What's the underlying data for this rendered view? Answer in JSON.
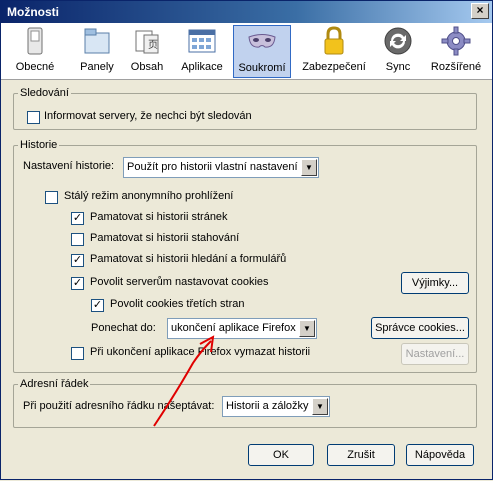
{
  "window": {
    "title": "Možnosti",
    "close_label": "×"
  },
  "toolbar": {
    "tabs": [
      {
        "label": "Obecné",
        "icon": "switch-icon"
      },
      {
        "label": "Panely",
        "icon": "tabs-icon"
      },
      {
        "label": "Obsah",
        "icon": "document-icon"
      },
      {
        "label": "Aplikace",
        "icon": "applications-icon"
      },
      {
        "label": "Soukromí",
        "icon": "mask-icon"
      },
      {
        "label": "Zabezpečení",
        "icon": "lock-icon"
      },
      {
        "label": "Sync",
        "icon": "sync-icon"
      },
      {
        "label": "Rozšířené",
        "icon": "gear-icon"
      }
    ],
    "active": "Soukromí"
  },
  "tracking": {
    "legend": "Sledování",
    "dnt_label": "Informovat servery, že nechci být sledován",
    "dnt_checked": false
  },
  "history": {
    "legend": "Historie",
    "settings_label": "Nastavení historie:",
    "settings_value": "Použít pro historii vlastní nastavení",
    "private_label": "Stálý režim anonymního prohlížení",
    "private_checked": false,
    "browsing_label": "Pamatovat si historii stránek",
    "browsing_checked": true,
    "download_label": "Pamatovat si historii stahování",
    "download_checked": false,
    "forms_label": "Pamatovat si historii hledání a formulářů",
    "forms_checked": true,
    "cookies_label": "Povolit serverům nastavovat cookies",
    "cookies_checked": true,
    "exceptions_button": "Výjimky...",
    "third_party_label": "Povolit cookies třetích stran",
    "third_party_checked": true,
    "keep_label": "Ponechat do:",
    "keep_value": "ukončení aplikace Firefox",
    "manage_cookies_button": "Správce cookies...",
    "clear_on_close_label": "Při ukončení aplikace Firefox vymazat historii",
    "clear_on_close_checked": false,
    "settings_button": "Nastavení..."
  },
  "location_bar": {
    "legend": "Adresní řádek",
    "suggest_label": "Při použití adresního řádku našeptávat:",
    "suggest_value": "Historii a záložky"
  },
  "footer": {
    "ok": "OK",
    "cancel": "Zrušit",
    "help": "Nápověda"
  },
  "colors": {
    "annotation_arrow": "#e00000",
    "active_tab": "#c1d2ee",
    "title_bar": "#0a246a"
  },
  "check_mark": "✓",
  "dropdown_arrow": "▼"
}
